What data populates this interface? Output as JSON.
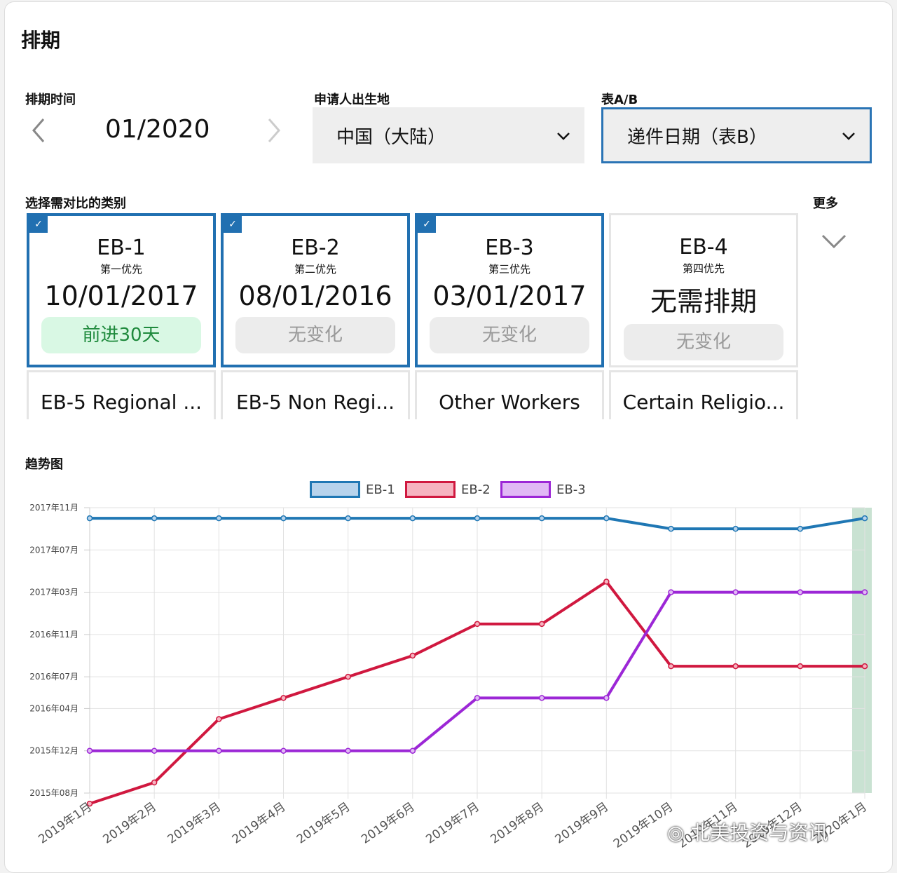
{
  "header": {
    "title": "排期"
  },
  "filters": {
    "date_label": "排期时间",
    "date_value": "01/2020",
    "prev_icon": "chevron-left-icon",
    "next_icon": "chevron-right-icon",
    "birthplace_label": "申请人出生地",
    "birthplace_value": "中国（大陆）",
    "table_label": "表A/B",
    "table_value": "递件日期（表B）"
  },
  "categories": {
    "label": "选择需对比的类别",
    "more_label": "更多",
    "cards": [
      {
        "code": "EB-1",
        "sub": "第一优先",
        "date": "10/01/2017",
        "change": "前进30天",
        "selected": true,
        "change_type": "advance"
      },
      {
        "code": "EB-2",
        "sub": "第二优先",
        "date": "08/01/2016",
        "change": "无变化",
        "selected": true,
        "change_type": "none"
      },
      {
        "code": "EB-3",
        "sub": "第三优先",
        "date": "03/01/2017",
        "change": "无变化",
        "selected": true,
        "change_type": "none"
      },
      {
        "code": "EB-4",
        "sub": "第四优先",
        "date": "无需排期",
        "change": "无变化",
        "selected": false,
        "change_type": "none"
      }
    ],
    "more_cards": [
      "EB-5 Regional ...",
      "EB-5 Non Regi...",
      "Other Workers",
      "Certain Religio..."
    ]
  },
  "trend": {
    "label": "趋势图",
    "watermark": "北美投资与资讯"
  },
  "chart_data": {
    "type": "line",
    "x": [
      "2019年1月",
      "2019年2月",
      "2019年3月",
      "2019年4月",
      "2019年5月",
      "2019年6月",
      "2019年7月",
      "2019年8月",
      "2019年9月",
      "2019年10月",
      "2019年11月",
      "2019年12月",
      "2020年1月"
    ],
    "y_ticks": [
      "2017年11月",
      "2017年07月",
      "2017年03月",
      "2016年11月",
      "2016年07月",
      "2016年04月",
      "2015年12月",
      "2015年08月"
    ],
    "y_range": [
      "2015-08",
      "2017-11"
    ],
    "series": [
      {
        "name": "EB-1",
        "color": "#1f77b4",
        "fill": "#b7d3ec",
        "values": [
          "2017-10",
          "2017-10",
          "2017-10",
          "2017-10",
          "2017-10",
          "2017-10",
          "2017-10",
          "2017-10",
          "2017-10",
          "2017-09",
          "2017-09",
          "2017-09",
          "2017-10"
        ]
      },
      {
        "name": "EB-2",
        "color": "#d0183f",
        "fill": "#f6b3c0",
        "values": [
          "2015-07",
          "2015-09",
          "2016-03",
          "2016-05",
          "2016-07",
          "2016-09",
          "2016-12",
          "2016-12",
          "2017-04",
          "2016-08",
          "2016-08",
          "2016-08",
          "2016-08"
        ]
      },
      {
        "name": "EB-3",
        "color": "#9c27d6",
        "fill": "#e1b9f5",
        "values": [
          "2015-12",
          "2015-12",
          "2015-12",
          "2015-12",
          "2015-12",
          "2015-12",
          "2016-05",
          "2016-05",
          "2016-05",
          "2017-03",
          "2017-03",
          "2017-03",
          "2017-03"
        ]
      }
    ],
    "highlight_last": true,
    "grid": true,
    "legend": "top-center"
  }
}
